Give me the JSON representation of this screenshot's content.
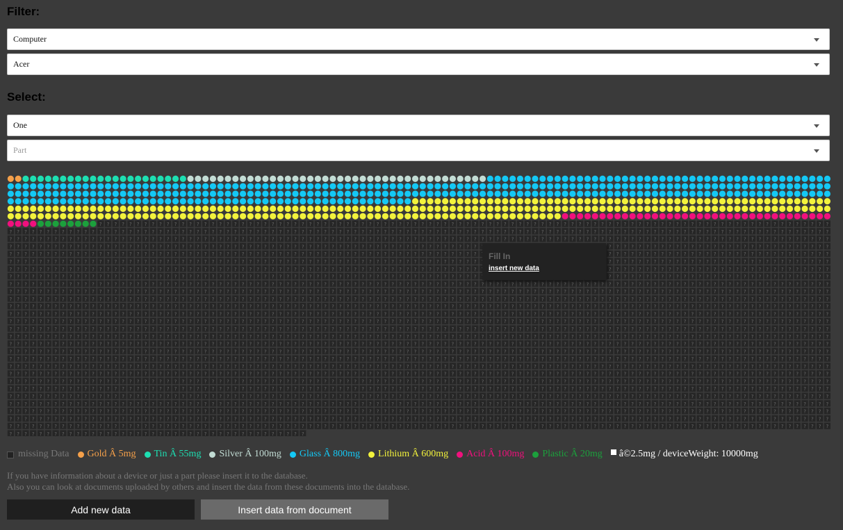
{
  "filter": {
    "heading": "Filter:",
    "device_type": {
      "value": "Computer"
    },
    "brand": {
      "value": "Acer"
    }
  },
  "select": {
    "heading": "Select:",
    "quantity": {
      "value": "One"
    },
    "part": {
      "placeholder": "Part"
    }
  },
  "grid": {
    "missing_glyph": "?",
    "counts": {
      "Gold": 2,
      "Tin": 22,
      "Silver": 40,
      "Glass": 320,
      "Lithium": 240,
      "Acid": 40,
      "Plastic": 8
    }
  },
  "tooltip": {
    "title": "Fill In",
    "link": "insert new data"
  },
  "legend": {
    "missing": {
      "label": "missing Data",
      "color": "#777777"
    },
    "items": [
      {
        "label": "Gold Â 5mg",
        "color": "#f5a04a"
      },
      {
        "label": "Tin Â 55mg",
        "color": "#1ddfb2"
      },
      {
        "label": "Silver Â 100mg",
        "color": "#c2dcd4"
      },
      {
        "label": "Glass Â 800mg",
        "color": "#14c8f5"
      },
      {
        "label": "Lithium Â 600mg",
        "color": "#f2f23c"
      },
      {
        "label": "Acid Â 100mg",
        "color": "#f0107d"
      },
      {
        "label": "Plastic Â 20mg",
        "color": "#1ca03c"
      }
    ],
    "unit": {
      "label": "â©2.5mg / deviceWeight: 10000mg",
      "color": "#ffffff"
    }
  },
  "info": {
    "line1": "If you have information about a device or just a part please insert it to the database.",
    "line2": "Also you can look at documents uploaded by others and insert the data from these documents into the database."
  },
  "buttons": {
    "add": "Add new data",
    "document": "Insert data from document"
  }
}
